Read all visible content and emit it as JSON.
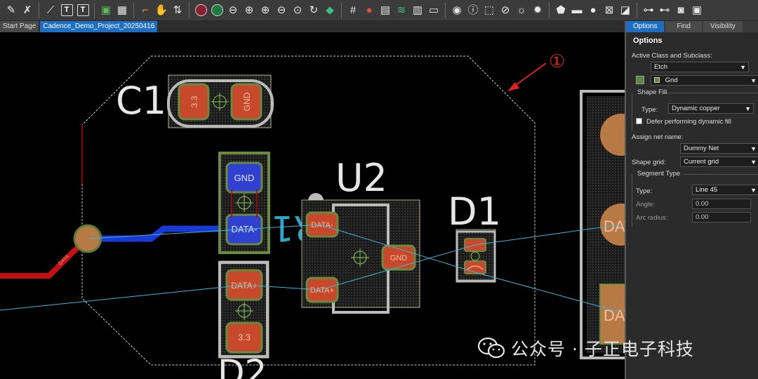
{
  "toolbar": {
    "icons": [
      "pin-icon",
      "unpin-icon",
      "route-icon",
      "text-icon",
      "text-edit-icon",
      "component-icon",
      "chip-icon",
      "slide-icon",
      "hand-icon",
      "fork-icon",
      "grid-1-icon",
      "grid-2-icon",
      "zoom-fit-icon",
      "zoom-in-icon",
      "zoom-out-icon",
      "zoom-prev-icon",
      "zoom-world-icon",
      "refresh-icon",
      "3d-icon",
      "grid-icon",
      "color-icon",
      "layers-icon",
      "stack-icon",
      "sheet-icon",
      "doc-icon",
      "eye-icon",
      "info-icon",
      "3d-box-icon",
      "shade-icon",
      "sun-icon",
      "sun-small-icon",
      "shape-add-icon",
      "rect-icon",
      "circle-icon",
      "select-shape-icon",
      "void-icon",
      "tree-icon",
      "merge-icon",
      "camera-icon",
      "drc-icon"
    ]
  },
  "doc_tabs": [
    {
      "label": "Start Page"
    },
    {
      "label": "Cadence_Demo_Project_20250416"
    }
  ],
  "canvas": {
    "annotation_marker": "①",
    "refdes": {
      "c1": "C1",
      "u2": "U2",
      "d1": "D1",
      "r1": "R1",
      "d2": "D2"
    },
    "pad_labels": {
      "c1_left": "3.3",
      "c1_right": "GND",
      "r1_top": "GND",
      "r1_bottom": "DATA-",
      "d2_top": "DATA+",
      "d2_bottom": "3.3",
      "u2_pin1": "DATA-",
      "u2_pin2": "DATA+",
      "u2_pin3": "GND",
      "right_top": "DAT",
      "right_bottom": "DAT"
    },
    "trace_label": "DATA"
  },
  "panel": {
    "tabs": [
      {
        "label": "Options"
      },
      {
        "label": "Find"
      },
      {
        "label": "Visibility"
      }
    ],
    "header": "Options",
    "active_class_label": "Active Class and Subclass:",
    "class_value": "Etch",
    "subclass_value": "Gnd",
    "shape_fill_label": "Shape Fill",
    "type_label": "Type:",
    "fill_type_value": "Dynamic copper",
    "defer_label": "Defer performing dynamic fill",
    "assign_net_label": "Assign net name:",
    "net_value": "Dummy Net",
    "shape_grid_label": "Shape grid:",
    "shape_grid_value": "Current grid",
    "segment_type_label": "Segment Type",
    "seg_type_label": "Type:",
    "seg_type_value": "Line 45",
    "angle_label": "Angle:",
    "angle_value": "0.00",
    "arc_radius_label": "Arc radius:",
    "arc_radius_value": "0.00",
    "colors": {
      "subclass_swatch": "#5a8a3a",
      "accent": "#1e6fc4"
    }
  },
  "watermark": {
    "text": "公众号 · 子正电子科技"
  }
}
